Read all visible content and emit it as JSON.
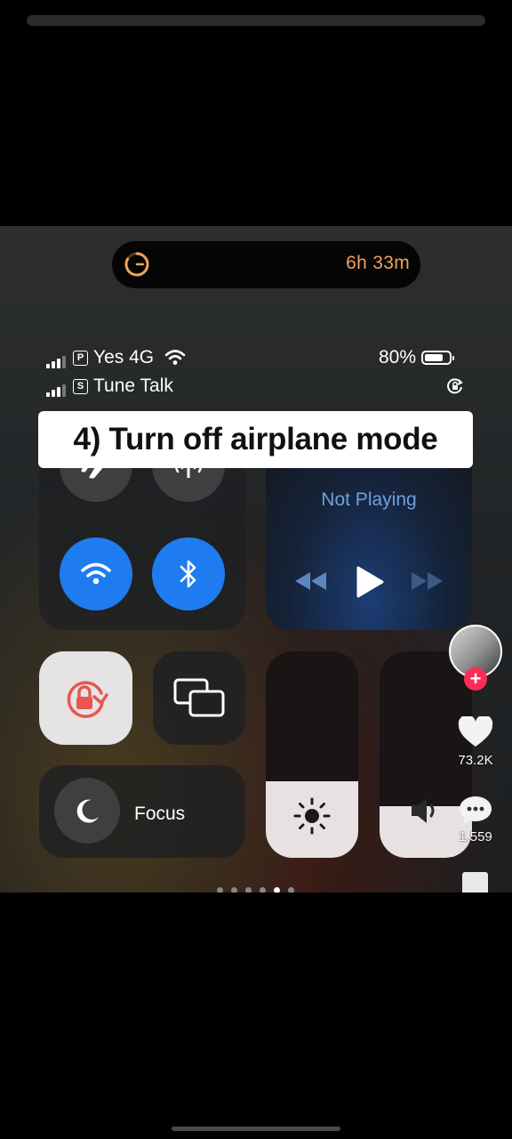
{
  "island": {
    "timer": "6h 33m"
  },
  "status": {
    "carrier1": "Yes 4G",
    "carrier1_badge": "P",
    "carrier2": "Tune Talk",
    "carrier2_badge": "S",
    "battery": "80%",
    "battery_level": 0.8
  },
  "caption": "4) Turn off airplane mode",
  "control_center": {
    "airplane_mode": false,
    "cellular_data": false,
    "wifi": true,
    "bluetooth": true,
    "now_playing": "Not Playing",
    "orientation_lock": true,
    "focus_label": "Focus",
    "brightness_level": 0.37,
    "volume_level": 0.25,
    "page_dots": 6,
    "active_page": 5
  },
  "sidebar": {
    "likes": "73.2K",
    "comments": "1,559"
  },
  "colors": {
    "accent_blue": "#1f7cf0",
    "timer_orange": "#f0a25a",
    "tiktok_red": "#fe2c55"
  }
}
